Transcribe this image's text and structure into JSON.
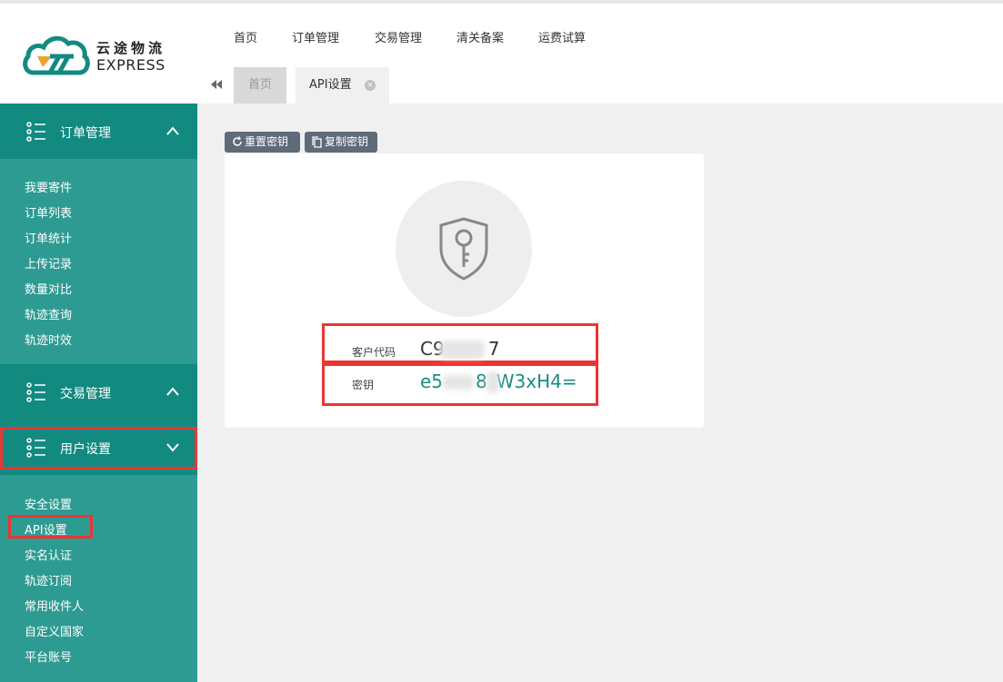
{
  "logo": {
    "cn": "云途物流",
    "en": "EXPRESS"
  },
  "topnav": [
    "首页",
    "订单管理",
    "交易管理",
    "清关备案",
    "运费试算"
  ],
  "tabs": {
    "home": "首页",
    "api": "API设置",
    "close": "×"
  },
  "sidebar": {
    "order": {
      "title": "订单管理",
      "items": [
        "我要寄件",
        "订单列表",
        "订单统计",
        "上传记录",
        "数量对比",
        "轨迹查询",
        "轨迹时效"
      ]
    },
    "trade": {
      "title": "交易管理"
    },
    "user": {
      "title": "用户设置",
      "items": [
        "安全设置",
        "API设置",
        "实名认证",
        "轨迹订阅",
        "常用收件人",
        "自定义国家",
        "平台账号"
      ]
    }
  },
  "actions": {
    "reset": "重置密钥",
    "copy": "复制密钥"
  },
  "api": {
    "customer_code_label": "客户代码",
    "customer_code_value": "C9",
    "customer_code_tail": "7",
    "secret_label": "密钥",
    "secret_head": "e5",
    "secret_mid": "8",
    "secret_tail": "W3xH4="
  },
  "colors": {
    "sidebar": "#2e9b92",
    "sidebar_header": "#138a80",
    "accent": "#1b8c82",
    "highlight": "#e33333"
  }
}
